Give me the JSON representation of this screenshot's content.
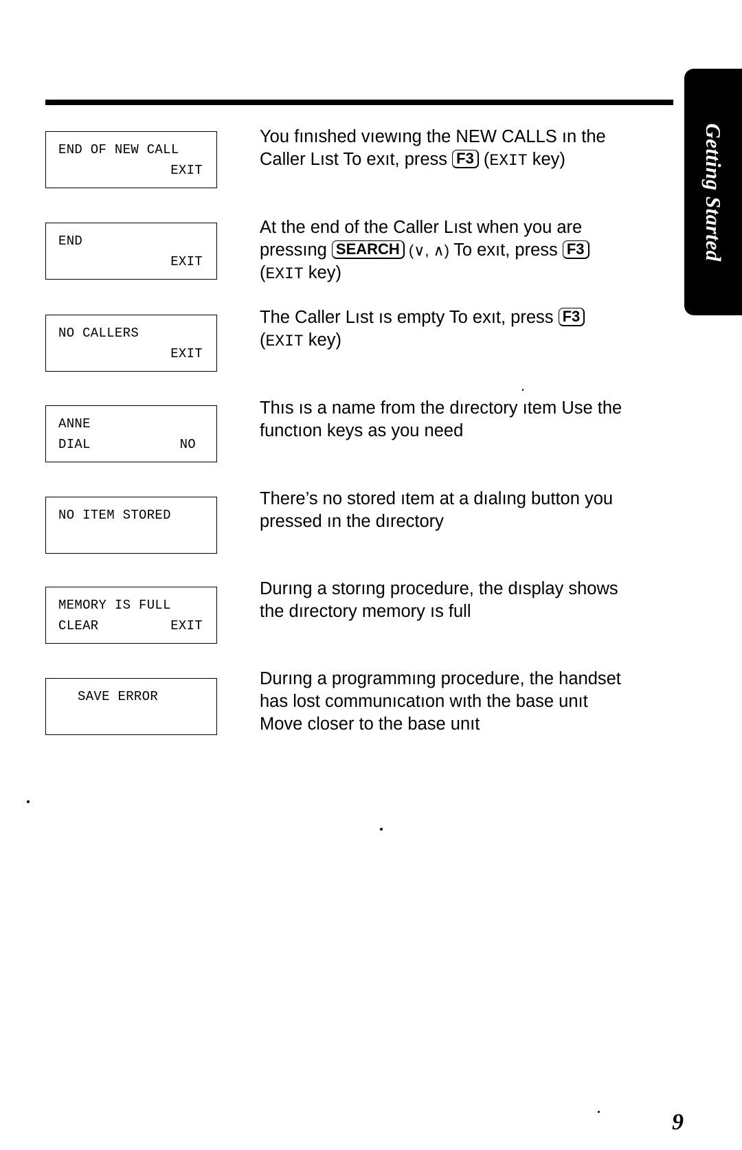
{
  "section_tab": {
    "label": "Getting Started"
  },
  "page_number": "9",
  "entries": [
    {
      "display": {
        "line1_left": "END OF NEW CALL",
        "line1_right": "",
        "line2_left": "",
        "line2_right": "EXIT"
      },
      "desc": {
        "l1": "You fınıshed vıewıng the NEW CALLS ın the",
        "l2a": "Caller Lıst  To exıt, press ",
        "l2key": "F3",
        "l2b": " (",
        "l2lcd": "EXIT",
        "l2c": " key)"
      }
    },
    {
      "display": {
        "line1_left": "END",
        "line1_right": "",
        "line2_left": "",
        "line2_right": "EXIT"
      },
      "desc": {
        "l1": "At the end of the Caller Lıst when you are",
        "l2a": "pressıng ",
        "l2key1": "SEARCH",
        "l2arrows": " (∨, ∧) ",
        "l2b": " To exıt, press ",
        "l2key2": "F3",
        "l3a": "(",
        "l3lcd": "EXIT",
        "l3b": " key)"
      }
    },
    {
      "display": {
        "line1_left": "NO CALLERS",
        "line1_right": "",
        "line2_left": "",
        "line2_right": "EXIT"
      },
      "desc": {
        "l1a": "The Caller Lıst ıs empty  To exıt, press ",
        "l1key": "F3",
        "l2a": "(",
        "l2lcd": "EXIT",
        "l2b": " key)"
      }
    },
    {
      "display": {
        "line1_left": "ANNE",
        "line1_right": "",
        "line2_left": "DIAL",
        "line2_right": "NO"
      },
      "desc": {
        "l1": "Thıs ıs a name from the dırectory ıtem  Use the",
        "l2": "functıon keys as you need"
      }
    },
    {
      "display": {
        "line1_left": "NO ITEM STORED",
        "line1_right": "",
        "line2_left": "",
        "line2_right": ""
      },
      "desc": {
        "l1": "There’s no stored ıtem at a dıalıng button you",
        "l2": "pressed ın the dırectory"
      }
    },
    {
      "display": {
        "line1_left": "MEMORY IS FULL",
        "line1_right": "",
        "line2_left": "CLEAR",
        "line2_right": "EXIT"
      },
      "desc": {
        "l1": "Durıng a storıng procedure, the dısplay shows",
        "l2": "the dırectory memory ıs full"
      }
    },
    {
      "display": {
        "line1_center": "SAVE ERROR"
      },
      "desc": {
        "l1": "Durıng a programmıng procedure, the handset",
        "l2": "has lost communıcatıon wıth the base unıt",
        "l3": "Move closer to the base unıt"
      }
    }
  ]
}
